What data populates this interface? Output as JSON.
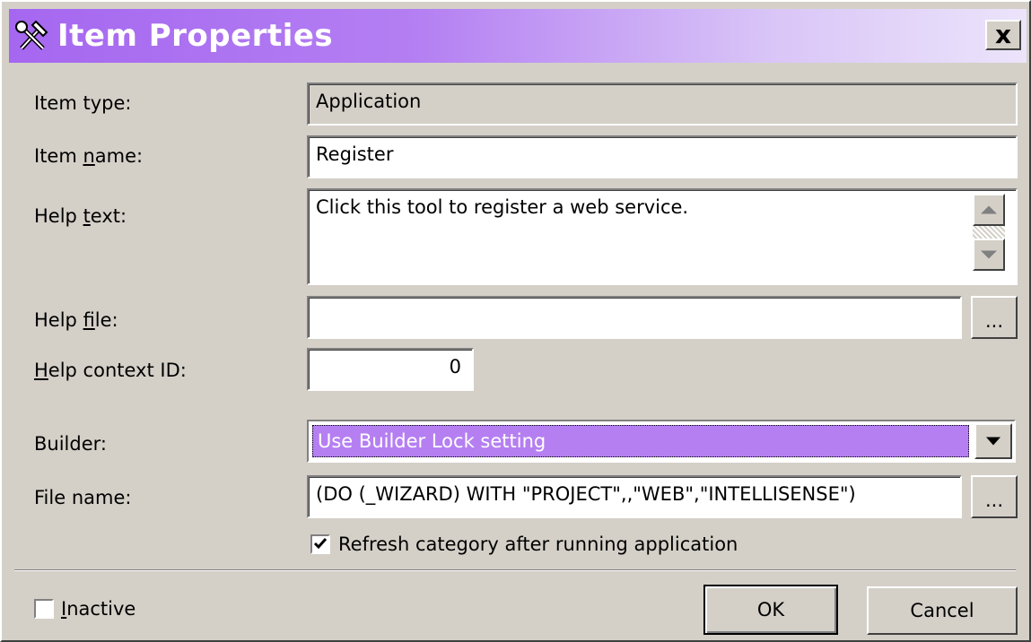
{
  "window": {
    "title": "Item Properties",
    "title_icon": "tools-icon",
    "close_label": "x"
  },
  "form": {
    "item_type": {
      "label": "Item type:",
      "value": "Application"
    },
    "item_name": {
      "label_pre": "Item ",
      "label_u": "n",
      "label_post": "ame:",
      "value": "Register"
    },
    "help_text": {
      "label_pre": "Help ",
      "label_u": "t",
      "label_post": "ext:",
      "value": "Click this tool to register a web service."
    },
    "help_file": {
      "label_pre": "Help ",
      "label_u": "f",
      "label_post": "ile:",
      "value": "",
      "browse_label": "..."
    },
    "help_context_id": {
      "label_pre": "",
      "label_u": "H",
      "label_post": "elp context ID:",
      "value": "0"
    },
    "builder": {
      "label": "Builder:",
      "selected": "Use Builder Lock setting"
    },
    "file_name": {
      "label": "File name:",
      "value": "(DO (_WIZARD) WITH \"PROJECT\",,\"WEB\",\"INTELLISENSE\")",
      "browse_label": "..."
    },
    "refresh": {
      "label": "Refresh category after running application",
      "checked": true
    }
  },
  "footer": {
    "inactive": {
      "label_u": "I",
      "label_post": "nactive",
      "checked": false
    },
    "ok_label": "OK",
    "cancel_label": "Cancel"
  },
  "colors": {
    "accent": "#b57ff2",
    "face": "#d4d0c8"
  }
}
